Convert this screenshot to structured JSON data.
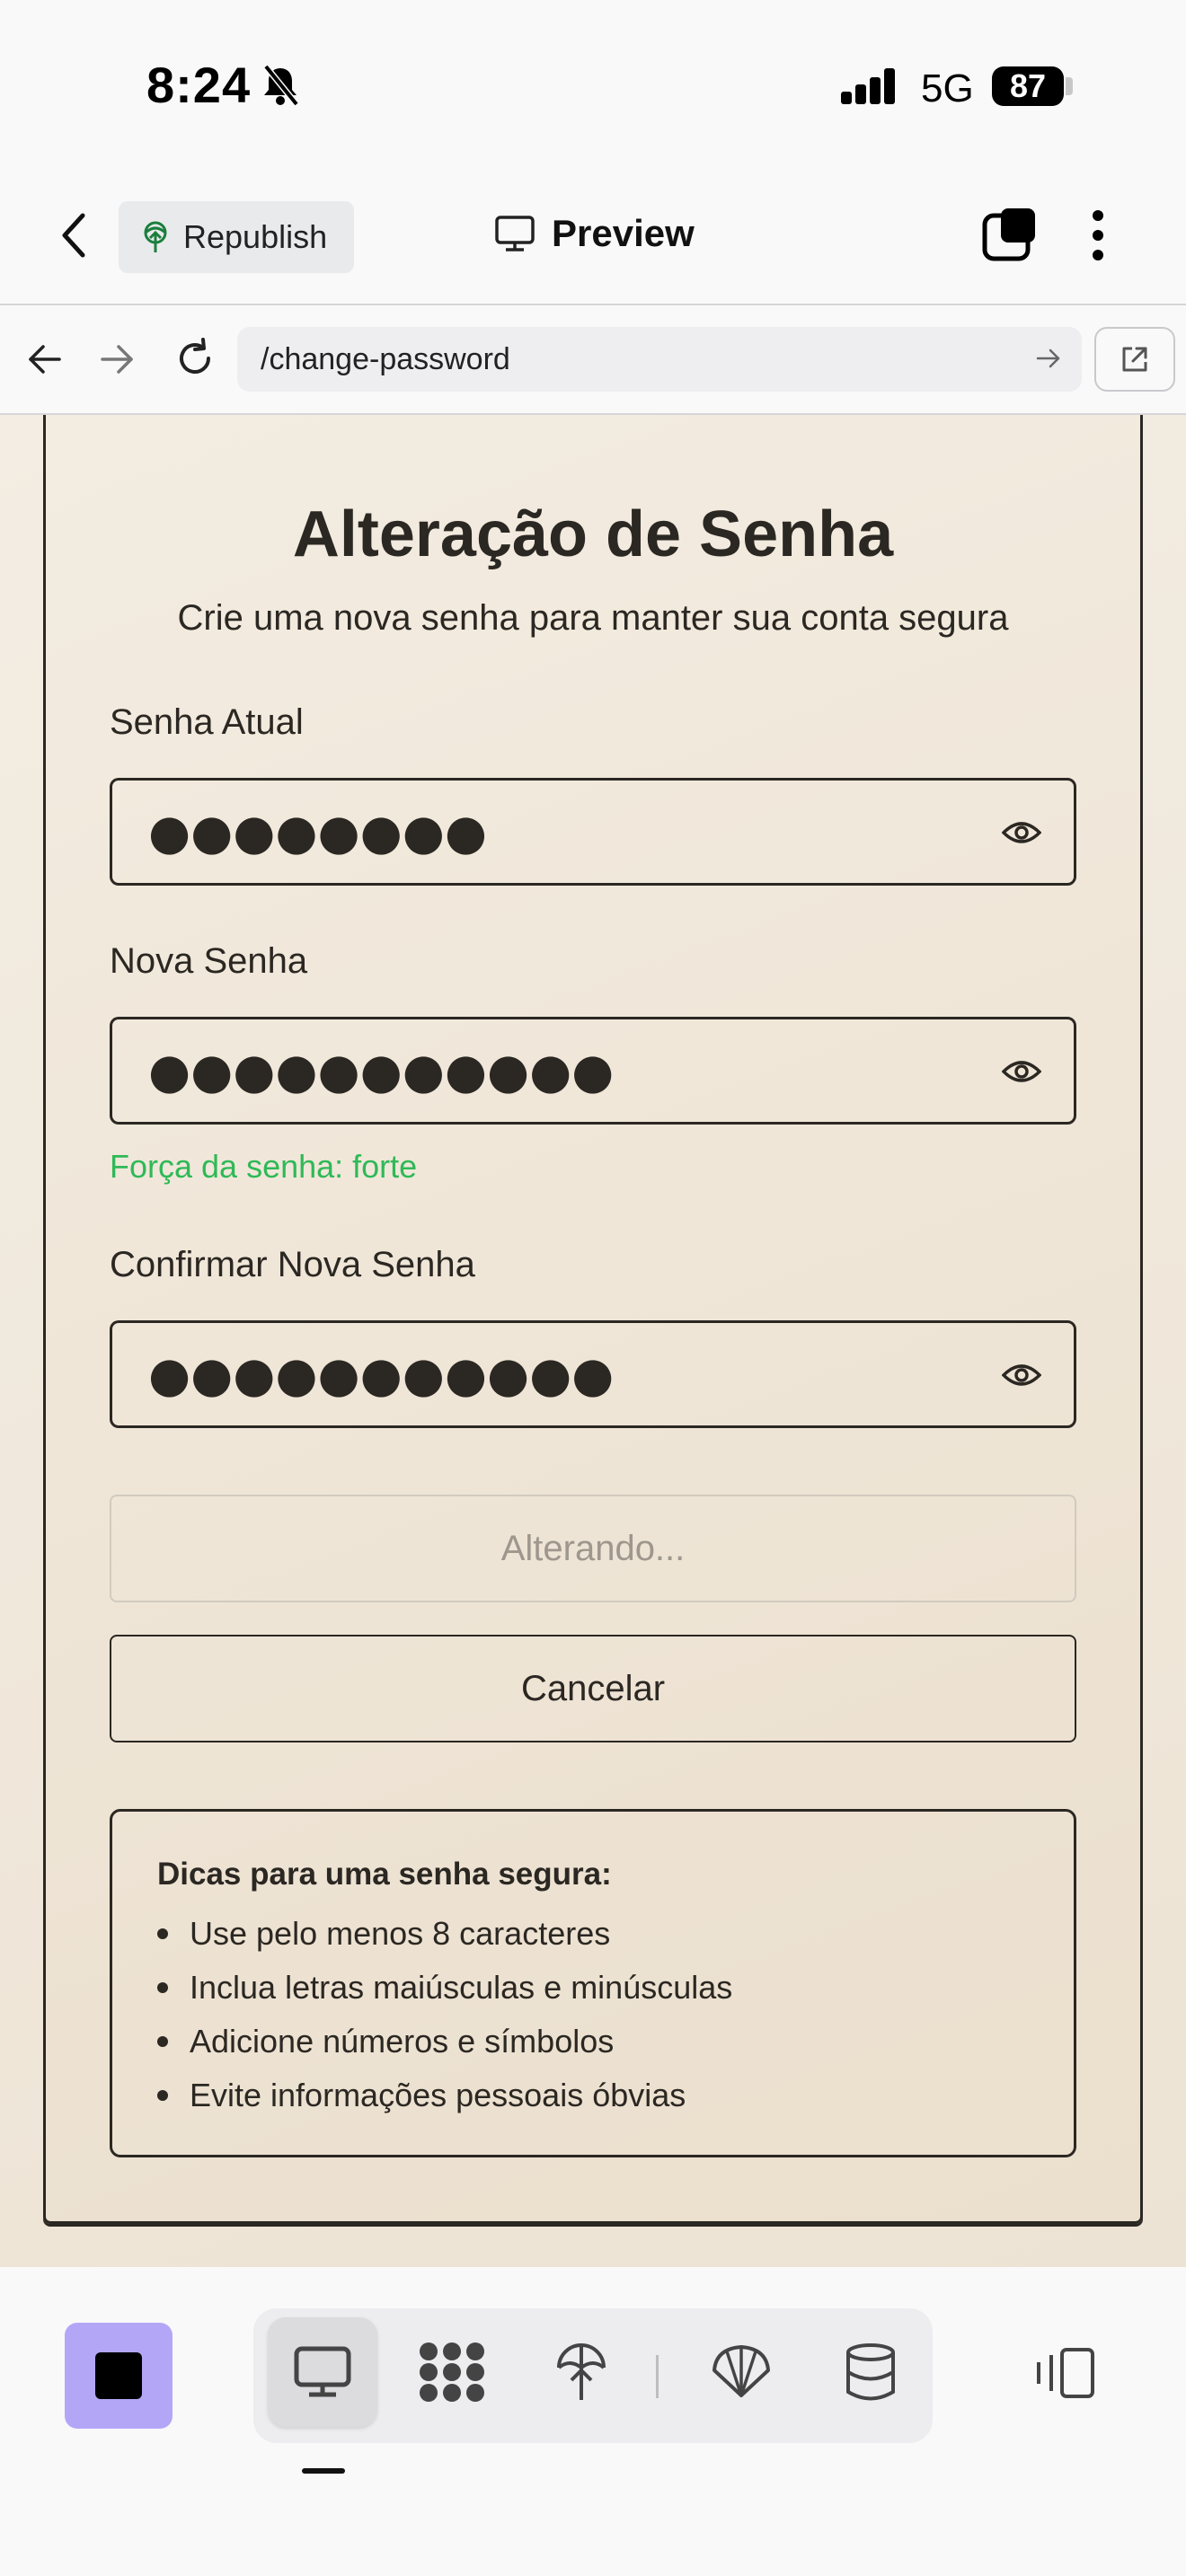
{
  "status_bar": {
    "time": "8:24",
    "network": "5G",
    "battery": "87"
  },
  "app_bar": {
    "republish_label": "Republish",
    "preview_label": "Preview"
  },
  "url_bar": {
    "url": "/change-password"
  },
  "form": {
    "title": "Alteração de Senha",
    "subtitle": "Crie uma nova senha para manter sua conta segura",
    "current_password": {
      "label": "Senha Atual",
      "value": "●●●●●●●●"
    },
    "new_password": {
      "label": "Nova Senha",
      "value": "●●●●●●●●●●●"
    },
    "strength_text": "Força da senha: forte",
    "confirm_password": {
      "label": "Confirmar Nova Senha",
      "value": "●●●●●●●●●●●"
    },
    "submit_label": "Alterando...",
    "cancel_label": "Cancelar"
  },
  "tips": {
    "title": "Dicas para uma senha segura:",
    "items": [
      "Use pelo menos 8 caracteres",
      "Inclua letras maiúsculas e minúsculas",
      "Adicione números e símbolos",
      "Evite informações pessoais óbvias"
    ]
  },
  "colors": {
    "strength": "#2fb957",
    "accent": "#b4a6f7",
    "ink": "#2b2722"
  },
  "toolbar_icons": [
    "monitor-icon",
    "apps-icon",
    "deploy-icon",
    "shell-icon",
    "database-icon"
  ]
}
